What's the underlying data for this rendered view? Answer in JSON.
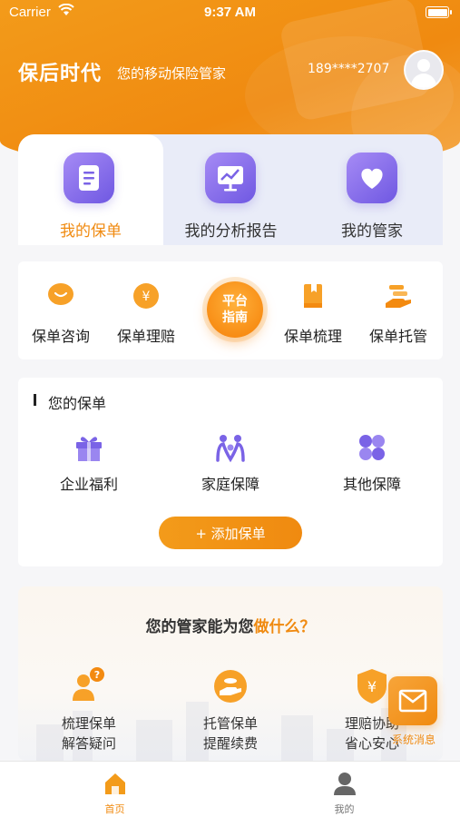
{
  "status_bar": {
    "carrier": "Carrier",
    "time": "9:37 AM"
  },
  "header": {
    "title": "保后时代",
    "subtitle": "您的移动保险管家",
    "phone": "189****2707"
  },
  "tabs": [
    {
      "label": "我的保单",
      "icon": "document-icon",
      "active": true
    },
    {
      "label": "我的分析报告",
      "icon": "chart-icon",
      "active": false
    },
    {
      "label": "我的管家",
      "icon": "heart-icon",
      "active": false
    }
  ],
  "services": [
    {
      "label": "保单咨询",
      "icon": "chat-bubble-icon"
    },
    {
      "label": "保单理赔",
      "icon": "yen-coin-icon"
    },
    {
      "label": "保单梳理",
      "icon": "book-icon"
    },
    {
      "label": "保单托管",
      "icon": "hand-icon"
    }
  ],
  "platform_guide": {
    "line1": "平台",
    "line2": "指南"
  },
  "my_policies": {
    "title": "您的保单",
    "items": [
      {
        "label": "企业福利",
        "icon": "gift-icon"
      },
      {
        "label": "家庭保障",
        "icon": "family-icon"
      },
      {
        "label": "其他保障",
        "icon": "four-leaf-icon"
      }
    ],
    "add_button": "+ 添加保单"
  },
  "butler": {
    "title_prefix": "您的管家能为您",
    "title_highlight": "做什么？",
    "items": [
      {
        "line1": "梳理保单",
        "line2": "解答疑问",
        "icon": "question-person-icon"
      },
      {
        "line1": "托管保单",
        "line2": "提醒续费",
        "icon": "hand-coin-icon"
      },
      {
        "line1": "理赔协助",
        "line2": "省心安心",
        "icon": "yen-shield-icon"
      }
    ]
  },
  "floating_message": {
    "label": "系统消息",
    "icon": "mail-icon"
  },
  "tabbar": [
    {
      "label": "首页",
      "icon": "home-icon",
      "active": true
    },
    {
      "label": "我的",
      "icon": "user-icon",
      "active": false
    }
  ],
  "colors": {
    "accent": "#f08a10",
    "purple": "#7a63e6",
    "background": "#f6f6f8"
  }
}
